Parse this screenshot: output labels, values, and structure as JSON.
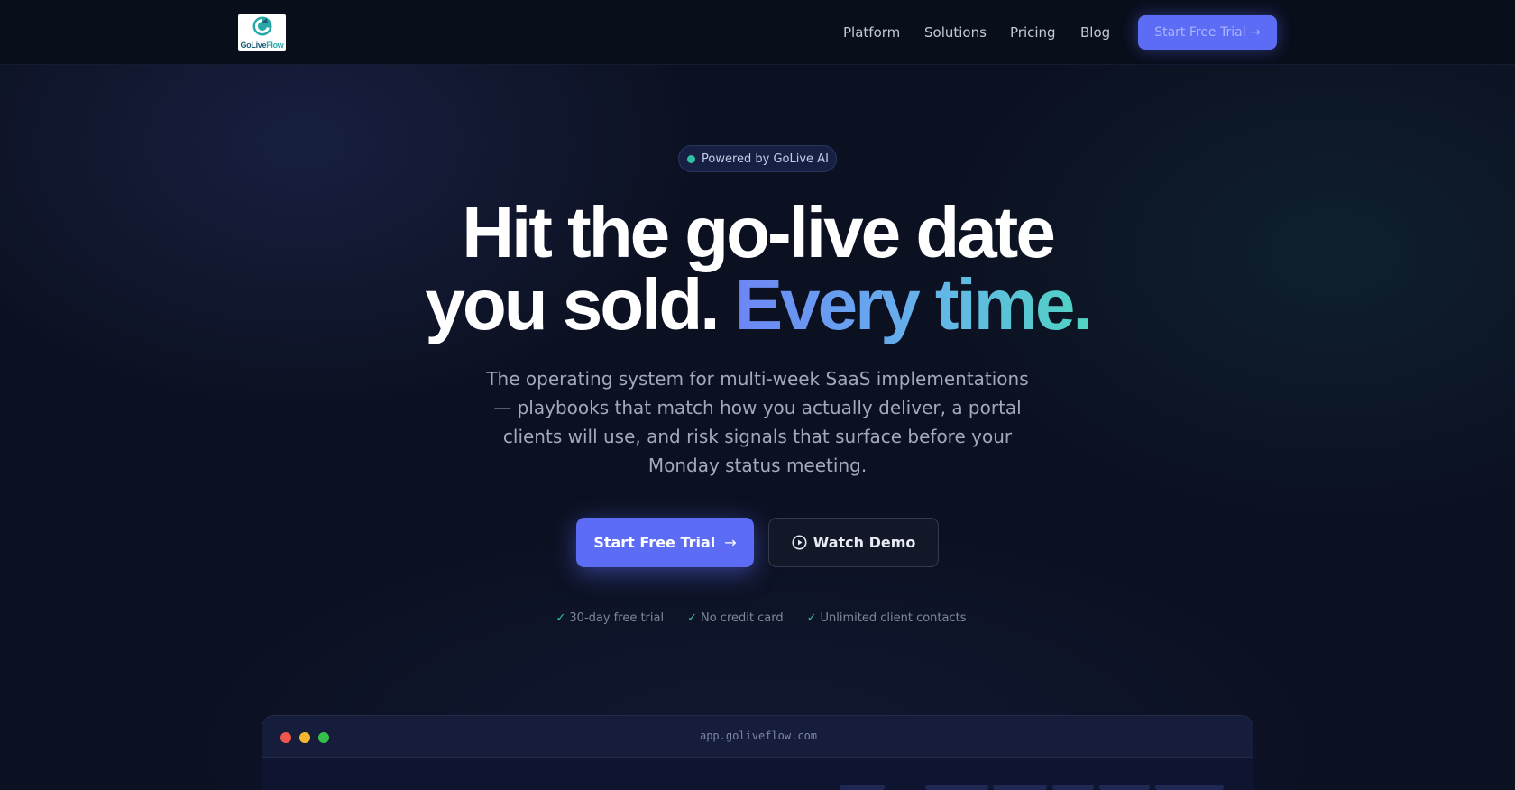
{
  "nav": {
    "logo": {
      "text_go": "GoLive",
      "text_flow": "Flow",
      "icon": "refresh-arrow-icon"
    },
    "links": [
      "Platform",
      "Solutions",
      "Pricing",
      "Blog"
    ],
    "cta_label": "Start Free Trial →"
  },
  "badge": {
    "label": "Powered by GoLive AI",
    "dot_color": "#2fc0a6"
  },
  "hero": {
    "headline_line1": "Hit the go-live date",
    "headline_line2_plain": "you sold.",
    "headline_line2_accent": "Every time.",
    "subtitle": "The operating system for multi-week SaaS implementations — playbooks that match how you actually deliver, a portal clients will use, and risk signals that surface before your Monday status meeting.",
    "primary_button": {
      "label": "Start Free Trial",
      "arrow": "→"
    },
    "secondary_button": {
      "label": "Watch Demo",
      "icon": "play-circle-icon"
    },
    "perks": [
      "30-day free trial",
      "No credit card",
      "Unlimited client contacts"
    ]
  },
  "app_window": {
    "url": "app.goliveflow.com"
  },
  "colors": {
    "background": "#0c1122",
    "accent": "#5c6cf5",
    "teal": "#2fc0a6",
    "gradient_start": "#6d86f6",
    "gradient_end": "#4fd4c2"
  }
}
